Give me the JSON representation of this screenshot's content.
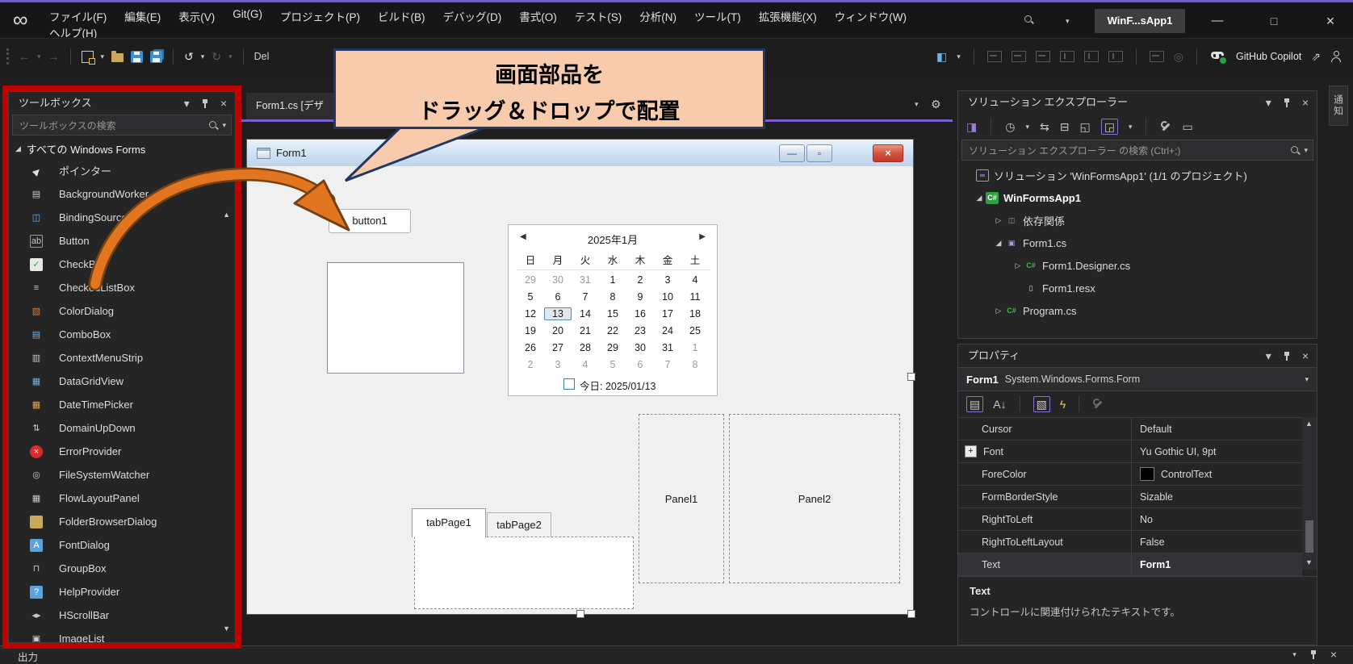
{
  "colors": {
    "accent_purple": "#7a5fd0",
    "annotation_red": "#c10000",
    "callout_bg": "#F8CBAD",
    "callout_border": "#1F3864",
    "arrow_orange": "#E2751F",
    "titlebar": "#161617",
    "panel_bg": "#252526",
    "form_bg": "#f0f0f0",
    "close_red": "#c94534",
    "copilot_green": "#2ea043"
  },
  "window": {
    "search_box_text": "WinF...sApp1",
    "controls": {
      "minimize": "—",
      "maximize": "□",
      "close": "×"
    }
  },
  "menu": {
    "row1": [
      "ファイル(F)",
      "編集(E)",
      "表示(V)",
      "Git(G)",
      "プロジェクト(P)",
      "ビルド(B)",
      "デバッグ(D)",
      "書式(O)",
      "テスト(S)",
      "分析(N)",
      "ツール(T)",
      "拡張機能(X)",
      "ウィンドウ(W)"
    ],
    "row2": [
      "ヘルプ(H)"
    ]
  },
  "toolbar": {
    "left": [
      {
        "name": "navigate-backward-icon",
        "glyph": "←",
        "fg": "#5e5e5e"
      },
      {
        "name": "navigate-backward-dropdown",
        "glyph": "▾",
        "fg": "#5e5e5e",
        "small": 1
      },
      {
        "name": "navigate-forward-icon",
        "glyph": "→",
        "fg": "#5e5e5e"
      },
      {
        "sep": 1
      },
      {
        "name": "new-project-icon",
        "cls": "newproj"
      },
      {
        "name": "new-project-dropdown",
        "glyph": "▾",
        "fg": "#c8c8c8",
        "small": 1
      },
      {
        "name": "open-folder-icon",
        "cls": "folderic"
      },
      {
        "name": "save-icon",
        "cls": "floppy"
      },
      {
        "name": "save-all-icon",
        "cls": "floppy all"
      },
      {
        "sep": 1
      },
      {
        "name": "undo-icon",
        "glyph": "↺",
        "fg": "#e8e8e8"
      },
      {
        "name": "undo-dropdown",
        "glyph": "▾",
        "fg": "#c8c8c8",
        "small": 1
      },
      {
        "name": "redo-icon",
        "glyph": "↻",
        "fg": "#5e5e5e"
      },
      {
        "name": "redo-dropdown",
        "glyph": "▾",
        "fg": "#5e5e5e",
        "small": 1
      },
      {
        "sep": 1
      },
      {
        "name": "debug-target-partial-text",
        "text": "Del",
        "fg": "#d0d0d0"
      }
    ],
    "right": [
      {
        "name": "window-layout-icon",
        "glyph": "◧",
        "fg": "#6cb3e8"
      },
      {
        "name": "window-layout-dropdown",
        "glyph": "▾",
        "fg": "#c8c8c8",
        "small": 1
      },
      {
        "sep": 1
      },
      {
        "name": "align-lefts-icon",
        "cls": "al"
      },
      {
        "name": "align-centers-icon",
        "cls": "al"
      },
      {
        "name": "align-rights-icon",
        "cls": "al"
      },
      {
        "name": "align-tops-icon",
        "cls": "al t"
      },
      {
        "name": "align-middles-icon",
        "cls": "al t"
      },
      {
        "name": "align-bottoms-icon",
        "cls": "al t"
      },
      {
        "sep": 1
      },
      {
        "name": "make-same-size-icon",
        "cls": "al"
      },
      {
        "name": "zoom-icon",
        "glyph": "◎",
        "fg": "#5c5c5c"
      },
      {
        "sep": 1
      },
      {
        "name": "copilot-icon",
        "cls": "copilot"
      },
      {
        "name": "copilot-label",
        "text": "GitHub Copilot",
        "fg": "#e8e8e8"
      },
      {
        "name": "share-icon",
        "glyph": "⇗",
        "fg": "#c8c8c8"
      },
      {
        "name": "feedback-person-icon",
        "cls": "person"
      }
    ]
  },
  "callout": {
    "line1": "画面部品を",
    "line2": "ドラッグ＆ドロップで配置"
  },
  "editor": {
    "tab_label": "Form1.cs [デザ"
  },
  "toolbox": {
    "title": "ツールボックス",
    "search_placeholder": "ツールボックスの検索",
    "category": "すべての Windows Forms",
    "items": [
      {
        "label": "ポインター",
        "icon": "pointer-icon",
        "glyph": "▶",
        "fg": "#e0e0e0",
        "rot": 1
      },
      {
        "label": "BackgroundWorker",
        "icon": "backgroundworker-icon",
        "glyph": "▤",
        "fg": "#c8c8c8"
      },
      {
        "label": "BindingSource",
        "icon": "bindingsource-icon",
        "glyph": "◫",
        "fg": "#6cb3e8"
      },
      {
        "label": "Button",
        "icon": "button-icon",
        "glyph": "ab",
        "fg": "#c8c8c8",
        "border": "#9a9a9a"
      },
      {
        "label": "CheckBox",
        "icon": "checkbox-icon",
        "glyph": "✓",
        "fg": "#3f9c43",
        "bg": "#e8e8e8"
      },
      {
        "label": "CheckedListBox",
        "icon": "checkedlistbox-icon",
        "glyph": "≡",
        "fg": "#c8c8c8"
      },
      {
        "label": "ColorDialog",
        "icon": "colordialog-icon",
        "glyph": "▧",
        "fg": "#cf7d4e"
      },
      {
        "label": "ComboBox",
        "icon": "combobox-icon",
        "glyph": "▤",
        "fg": "#6cb3e8"
      },
      {
        "label": "ContextMenuStrip",
        "icon": "contextmenustrip-icon",
        "glyph": "▥",
        "fg": "#c8c8c8"
      },
      {
        "label": "DataGridView",
        "icon": "datagridview-icon",
        "glyph": "▦",
        "fg": "#6cb3e8"
      },
      {
        "label": "DateTimePicker",
        "icon": "datetimepicker-icon",
        "glyph": "▦",
        "fg": "#e0a84c"
      },
      {
        "label": "DomainUpDown",
        "icon": "domainupdown-icon",
        "glyph": "⇅",
        "fg": "#c8c8c8"
      },
      {
        "label": "ErrorProvider",
        "icon": "errorprovider-icon",
        "glyph": "×",
        "fg": "#ffffff",
        "bg": "#d92b2b",
        "round": 1
      },
      {
        "label": "FileSystemWatcher",
        "icon": "filesystemwatcher-icon",
        "glyph": "◎",
        "fg": "#c8c8c8"
      },
      {
        "label": "FlowLayoutPanel",
        "icon": "flowlayoutpanel-icon",
        "glyph": "▦",
        "fg": "#c8c8c8"
      },
      {
        "label": "FolderBrowserDialog",
        "icon": "folderbrowserdialog-icon",
        "glyph": "",
        "bg": "#c9a85c"
      },
      {
        "label": "FontDialog",
        "icon": "fontdialog-icon",
        "glyph": "A",
        "fg": "#ffffff",
        "bg": "#5ba3e0"
      },
      {
        "label": "GroupBox",
        "icon": "groupbox-icon",
        "glyph": "⊓",
        "fg": "#c8c8c8"
      },
      {
        "label": "HelpProvider",
        "icon": "helpprovider-icon",
        "glyph": "?",
        "fg": "#ffffff",
        "bg": "#5ba3e0"
      },
      {
        "label": "HScrollBar",
        "icon": "hscrollbar-icon",
        "glyph": "◂▸",
        "fg": "#c8c8c8"
      },
      {
        "label": "ImageList",
        "icon": "imagelist-icon",
        "glyph": "▣",
        "fg": "#c8c8c8"
      }
    ]
  },
  "form_designer": {
    "title": "Form1",
    "button_label": "button1",
    "tab1": "tabPage1",
    "tab2": "tabPage2",
    "panel1": "Panel1",
    "panel2": "Panel2"
  },
  "calendar": {
    "prev_arrow": "◀",
    "next_arrow": "▶",
    "header": "2025年1月",
    "weekdays": [
      "日",
      "月",
      "火",
      "水",
      "木",
      "金",
      "土"
    ],
    "rows": [
      [
        {
          "v": 29,
          "m": 1
        },
        {
          "v": 30,
          "m": 1
        },
        {
          "v": 31,
          "m": 1
        },
        {
          "v": 1
        },
        {
          "v": 2
        },
        {
          "v": 3
        },
        {
          "v": 4
        }
      ],
      [
        {
          "v": 5
        },
        {
          "v": 6
        },
        {
          "v": 7
        },
        {
          "v": 8
        },
        {
          "v": 9
        },
        {
          "v": 10
        },
        {
          "v": 11
        }
      ],
      [
        {
          "v": 12
        },
        {
          "v": 13,
          "sel": 1
        },
        {
          "v": 14
        },
        {
          "v": 15
        },
        {
          "v": 16
        },
        {
          "v": 17
        },
        {
          "v": 18
        }
      ],
      [
        {
          "v": 19
        },
        {
          "v": 20
        },
        {
          "v": 21
        },
        {
          "v": 22
        },
        {
          "v": 23
        },
        {
          "v": 24
        },
        {
          "v": 25
        }
      ],
      [
        {
          "v": 26
        },
        {
          "v": 27
        },
        {
          "v": 28
        },
        {
          "v": 29
        },
        {
          "v": 30
        },
        {
          "v": 31
        },
        {
          "v": 1,
          "m": 1
        }
      ],
      [
        {
          "v": 2,
          "m": 1
        },
        {
          "v": 3,
          "m": 1
        },
        {
          "v": 4,
          "m": 1
        },
        {
          "v": 5,
          "m": 1
        },
        {
          "v": 6,
          "m": 1
        },
        {
          "v": 7,
          "m": 1
        },
        {
          "v": 8,
          "m": 1
        }
      ]
    ],
    "today_label": "今日: 2025/01/13"
  },
  "solution_explorer": {
    "title": "ソリューション エクスプローラー",
    "search_placeholder": "ソリューション エクスプローラー の検索 (Ctrl+;)",
    "toolbar": [
      {
        "name": "switch-views-icon",
        "glyph": "◨",
        "fg": "#9b7bd4"
      },
      {
        "sep": 1
      },
      {
        "name": "pending-changes-filter-icon",
        "glyph": "◷",
        "fg": "#c8c8c8"
      },
      {
        "name": "filter-dropdown",
        "glyph": "▾",
        "fg": "#c8c8c8",
        "small": 1
      },
      {
        "name": "sync-icon",
        "glyph": "⇆",
        "fg": "#c8c8c8"
      },
      {
        "name": "collapse-all-icon",
        "glyph": "⊟",
        "fg": "#c8c8c8"
      },
      {
        "name": "show-all-files-icon",
        "glyph": "◱",
        "fg": "#c8c8c8"
      },
      {
        "name": "sync-with-active-document-icon",
        "glyph": "◲",
        "fg": "#c8c8c8",
        "boxed": 1
      },
      {
        "name": "scope-dropdown",
        "glyph": "▾",
        "fg": "#c8c8c8",
        "small": 1
      },
      {
        "sep": 1
      },
      {
        "name": "properties-wrench-icon",
        "cls": "wrench"
      },
      {
        "name": "new-view-icon",
        "glyph": "▭",
        "fg": "#c8c8c8"
      }
    ],
    "tree": [
      {
        "level": 0,
        "exp": "",
        "icon": "solution-icon",
        "glyph": "∞",
        "fg": "#b08ae0",
        "border": "#9aa0a6",
        "label": "ソリューション 'WinFormsApp1' (1/1 のプロジェクト)"
      },
      {
        "level": 1,
        "exp": "open",
        "icon": "csharp-project-icon",
        "glyph": "C#",
        "fg": "#ffffff",
        "bg": "#2f9e44",
        "label": "WinFormsApp1",
        "bold": 1
      },
      {
        "level": 2,
        "exp": "closed",
        "icon": "dependencies-icon",
        "glyph": "◫",
        "fg": "#9aa0a6",
        "label": "依存関係"
      },
      {
        "level": 2,
        "exp": "open",
        "icon": "winform-icon",
        "glyph": "▣",
        "fg": "#b49be0",
        "label": "Form1.cs"
      },
      {
        "level": 3,
        "exp": "closed",
        "icon": "csharp-file-icon",
        "glyph": "C#",
        "fg": "#3fba4a",
        "label": "Form1.Designer.cs"
      },
      {
        "level": 3,
        "exp": "",
        "icon": "resx-file-icon",
        "glyph": "▯",
        "fg": "#d8d8d8",
        "label": "Form1.resx"
      },
      {
        "level": 2,
        "exp": "closed",
        "icon": "csharp-file-icon",
        "glyph": "C#",
        "fg": "#3fba4a",
        "label": "Program.cs"
      }
    ]
  },
  "properties": {
    "title": "プロパティ",
    "object_name": "Form1",
    "object_type": "System.Windows.Forms.Form",
    "toolbar": [
      {
        "name": "categorized-icon",
        "glyph": "▤",
        "fg": "#c8c8c8",
        "boxed": 1
      },
      {
        "name": "alphabetical-icon",
        "glyph": "A↓",
        "fg": "#c8c8c8"
      },
      {
        "sep": 1
      },
      {
        "name": "properties-view-icon",
        "glyph": "▧",
        "fg": "#c8c8c8",
        "boxed": 1
      },
      {
        "name": "events-icon",
        "glyph": "ϟ",
        "fg": "#f2c94c"
      },
      {
        "sep": 1
      },
      {
        "name": "property-pages-icon",
        "cls": "wrench muted"
      }
    ],
    "rows": [
      {
        "label": "Cursor",
        "value": "Default"
      },
      {
        "label": "Font",
        "value": "Yu Gothic UI, 9pt",
        "expandable": 1
      },
      {
        "label": "ForeColor",
        "value": "ControlText",
        "swatch": "#000000"
      },
      {
        "label": "FormBorderStyle",
        "value": "Sizable"
      },
      {
        "label": "RightToLeft",
        "value": "No"
      },
      {
        "label": "RightToLeftLayout",
        "value": "False"
      },
      {
        "label": "Text",
        "value": "Form1",
        "bold": 1,
        "selected": 1
      }
    ],
    "description_title": "Text",
    "description_body": "コントロールに関連付けられたテキストです。"
  },
  "panel_icons": [
    {
      "name": "chevron-down-icon",
      "glyph": "▾",
      "fg": "#c8c8c8"
    },
    {
      "name": "pin-icon",
      "cls": "pin"
    },
    {
      "name": "close-icon",
      "glyph": "×",
      "fg": "#c8c8c8"
    }
  ],
  "notifications": {
    "label": "通知"
  },
  "output": {
    "title": "出力"
  }
}
